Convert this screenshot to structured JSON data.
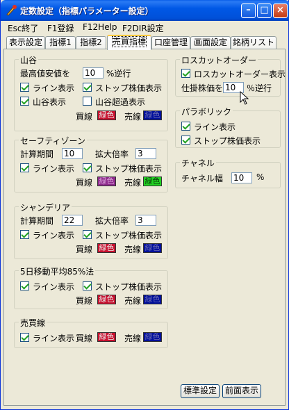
{
  "window": {
    "title": "定数設定（指標パラメーター設定）",
    "controls": {
      "minimize": "–",
      "maximize": "□",
      "close": "×"
    }
  },
  "menu": [
    "Esc終了",
    "F1登録",
    "F12Help",
    "F2DIR設定"
  ],
  "tabs": [
    "表示設定",
    "指標1",
    "指標2",
    "売買指標",
    "口座管理",
    "画面設定",
    "銘柄リスト"
  ],
  "active_tab": "売買指標",
  "yamatani": {
    "title": "山谷",
    "max_label": "最高値安値を",
    "max_value": "10",
    "max_unit": "%逆行",
    "line_label": "ライン表示",
    "stop_label": "ストップ株価表示",
    "yamatani_label": "山谷表示",
    "over_label": "山谷超過表示",
    "line_checked": true,
    "stop_checked": true,
    "yamatani_checked": true,
    "over_checked": false,
    "buy_label": "買線",
    "buy_color": "緑色",
    "sell_label": "売線",
    "sell_color": "緑色"
  },
  "safety": {
    "title": "セーフティゾーン",
    "period_label": "計算期間",
    "period_value": "10",
    "scale_label": "拡大倍率",
    "scale_value": "3",
    "line_label": "ライン表示",
    "stop_label": "ストップ株価表示",
    "buy_label": "買線",
    "buy_color": "緑色",
    "sell_label": "売線",
    "sell_color": "緑色"
  },
  "chandelier": {
    "title": "シャンデリア",
    "period_label": "計算期間",
    "period_value": "22",
    "scale_label": "拡大倍率",
    "scale_value": "3",
    "line_label": "ライン表示",
    "stop_label": "ストップ株価表示",
    "buy_label": "買線",
    "buy_color": "緑色",
    "sell_label": "売線",
    "sell_color": "緑色"
  },
  "ma85": {
    "title": "5日移動平均85%法",
    "line_label": "ライン表示",
    "stop_label": "ストップ株価表示",
    "buy_label": "買線",
    "buy_color": "緑色",
    "sell_label": "売線",
    "sell_color": "緑色"
  },
  "baibai": {
    "title": "売買線",
    "line_label": "ライン表示",
    "buy_label": "買線",
    "buy_color": "緑色",
    "sell_label": "売線",
    "sell_color": "緑色"
  },
  "losscut": {
    "title": "ロスカットオーダー",
    "show_label": "ロスカットオーダー表示",
    "price_label": "仕掛株価を",
    "price_value": "10",
    "price_unit": "％逆行"
  },
  "parabolic": {
    "title": "パラボリック",
    "line_label": "ライン表示",
    "stop_label": "ストップ株価表示"
  },
  "channel": {
    "title": "チャネル",
    "width_label": "チャネル幅",
    "width_value": "10",
    "width_unit": "%"
  },
  "buttons": {
    "default": "標準設定",
    "front": "前面表示"
  },
  "colors": {
    "red_swatch": "#c8102e",
    "blue_swatch": "#00109c",
    "purple_swatch": "#8e2a8c",
    "green_swatch": "#22d422",
    "titlebar": "#0058e6"
  }
}
